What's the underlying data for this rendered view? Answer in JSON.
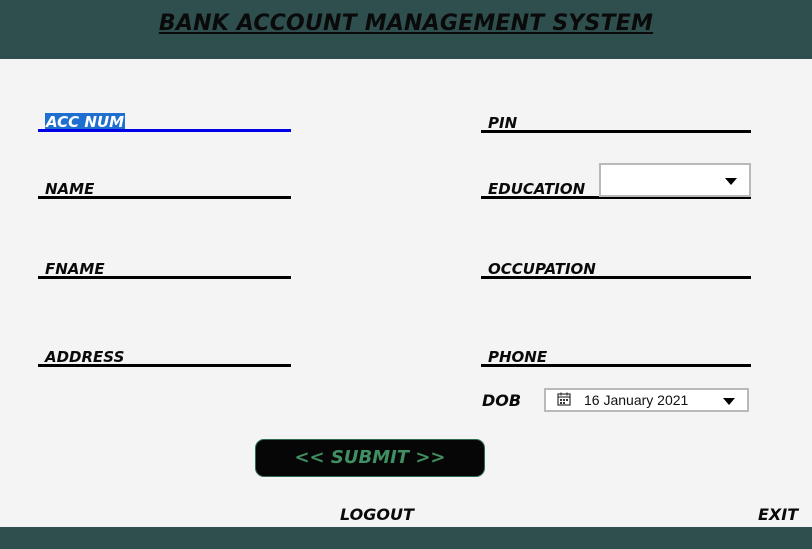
{
  "header": {
    "title": "BANK ACCOUNT MANAGEMENT SYSTEM"
  },
  "fields": {
    "acc_num": "ACC NUM",
    "name": "NAME",
    "fname": "FNAME",
    "address": "ADDRESS",
    "pin": "PIN",
    "education": "EDUCATION",
    "occupation": "OCCUPATION",
    "phone": "PHONE"
  },
  "education_dropdown": {
    "selected": ""
  },
  "dob": {
    "label": "DOB",
    "value": "16 January 2021",
    "icon": "calendar-icon"
  },
  "buttons": {
    "submit": "<< SUBMIT >>",
    "logout": "LOGOUT",
    "exit": "EXIT"
  },
  "colors": {
    "header_bg": "#2f4f4f",
    "active_underline": "#0000e6",
    "selection_highlight": "#1f6fd1",
    "submit_text": "#3f8f62"
  }
}
